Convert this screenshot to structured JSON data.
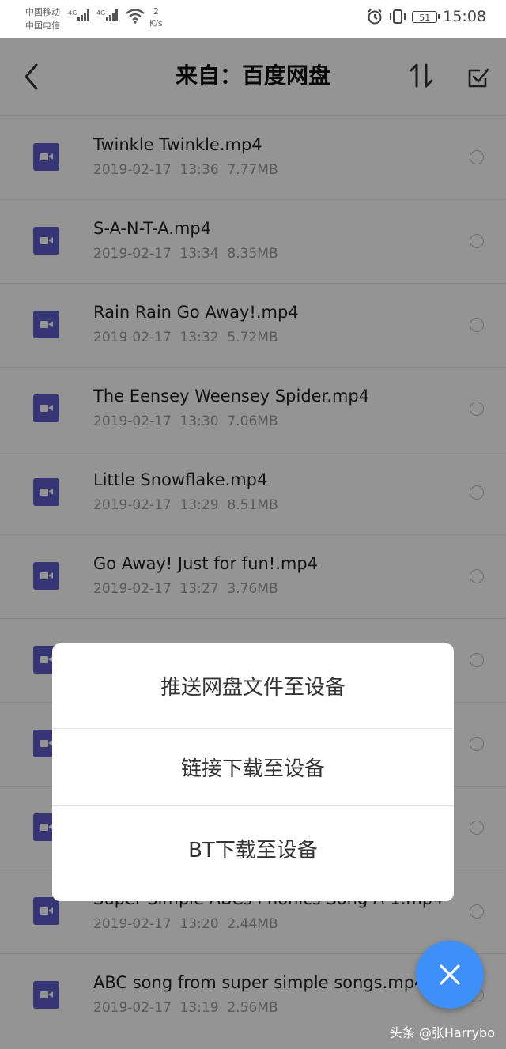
{
  "status_bar": {
    "carrier1": "中国移动",
    "carrier2": "中国电信",
    "net1": "4G",
    "net2": "4G",
    "speed_value": "2",
    "speed_unit": "K/s",
    "battery": "51",
    "time": "15:08"
  },
  "header": {
    "title": "来自：百度网盘"
  },
  "files": [
    {
      "name": "Twinkle Twinkle.mp4",
      "date": "2019-02-17",
      "time": "13:36",
      "size": "7.77MB"
    },
    {
      "name": "S-A-N-T-A.mp4",
      "date": "2019-02-17",
      "time": "13:34",
      "size": "8.35MB"
    },
    {
      "name": "Rain Rain Go Away!.mp4",
      "date": "2019-02-17",
      "time": "13:32",
      "size": "5.72MB"
    },
    {
      "name": "The Eensey Weensey Spider.mp4",
      "date": "2019-02-17",
      "time": "13:30",
      "size": "7.06MB"
    },
    {
      "name": "Little Snowflake.mp4",
      "date": "2019-02-17",
      "time": "13:29",
      "size": "8.51MB"
    },
    {
      "name": "Go Away! Just for fun!.mp4",
      "date": "2019-02-17",
      "time": "13:27",
      "size": "3.76MB"
    },
    {
      "name": "",
      "date": "",
      "time": "",
      "size": ""
    },
    {
      "name": "",
      "date": "",
      "time": "",
      "size": ""
    },
    {
      "name": "",
      "date": "",
      "time": "",
      "size": ""
    },
    {
      "name": "Super Simple ABCs Phonics Song A-1.mp4",
      "date": "2019-02-17",
      "time": "13:20",
      "size": "2.44MB"
    },
    {
      "name": "ABC song from super simple songs.mp4",
      "date": "2019-02-17",
      "time": "13:19",
      "size": "2.56MB"
    }
  ],
  "dialog": {
    "options": [
      "推送网盘文件至设备",
      "链接下载至设备",
      "BT下载至设备"
    ]
  },
  "watermark": "头条 @张Harrybo",
  "colors": {
    "accent": "#3e8ff7",
    "file_icon": "#5c5dc7"
  }
}
